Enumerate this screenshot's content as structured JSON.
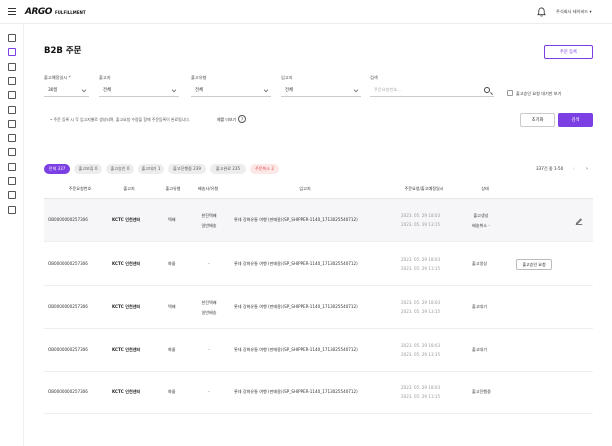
{
  "header": {
    "logo_main": "ARGO",
    "logo_sub": "FULFILLMENT",
    "account_name": "주식회사 테이비드 ▾"
  },
  "sidebar": {
    "icons": [
      "home-icon",
      "orders-icon",
      "user-icon",
      "card-icon",
      "box-icon",
      "document-icon",
      "list-icon",
      "truck-icon",
      "inbox-icon",
      "chart-icon",
      "settings-icon",
      "megaphone-icon",
      "book-icon"
    ]
  },
  "page": {
    "title": "B2B 주문",
    "register_button": "주문 등록"
  },
  "filters": {
    "date_label": "출고예정일시 *",
    "date_value": "30일",
    "shipper_label": "출고지",
    "shipper_value": "전체",
    "type_label": "출고유형",
    "type_value": "전체",
    "dest_label": "입고지",
    "dest_value": "전체",
    "search_label": "검색",
    "search_placeholder": "주문요청번호...",
    "checkbox_label": "출고승인 요청 대기만 보기"
  },
  "notice": {
    "text": "주문 등록 시 각 입고지별로 생성되며, 출고요청 수량을 함께 주문등록이 완료됩니다.",
    "help_link": "예를 더보기",
    "help_icon": "?"
  },
  "actions": {
    "reset_label": "초기화",
    "search_label": "검색"
  },
  "tabs": [
    {
      "label": "전체 337",
      "active": true
    },
    {
      "label": "출고보류 0",
      "active": false
    },
    {
      "label": "출고승인 0",
      "active": false
    },
    {
      "label": "출고대기 1",
      "active": false
    },
    {
      "label": "출고진행중 239",
      "active": false
    },
    {
      "label": "출고완료 235",
      "active": false
    },
    {
      "label": "주문취소 2",
      "active": false
    }
  ],
  "pagination": {
    "summary": "337건 중 1-50",
    "prev": "‹",
    "next": "›"
  },
  "table": {
    "columns": [
      "주문요청번호",
      "출고지",
      "출고유형",
      "배송사/유형",
      "입고지",
      "주문요청/출고예정일시",
      "상태"
    ],
    "rows": [
      {
        "order_no": "OB0000000257306",
        "shipper": "KCTC 인천센터",
        "type": "택배",
        "carrier": [
          "한진택배",
          "일반배송"
        ],
        "dest": "롯데 강화유통 여행 (판매용)(SP_SHIPPER-1140_1713025540712)",
        "dates": [
          "2023. 05. 29 18:03",
          "2023. 05. 29 13:15"
        ],
        "status": "출고생성",
        "status_sub": "배송취소 -",
        "action": "edit"
      },
      {
        "order_no": "OB0000000257306",
        "shipper": "KCTC 인천센터",
        "type": "화물",
        "carrier": [
          "-"
        ],
        "dest": "롯데 강화유통 여행 (판매용)(SP_SHIPPER-1140_1713025540712)",
        "dates": [
          "2023. 05. 29 18:03",
          "2023. 05. 29 13:15"
        ],
        "status": "출고생성",
        "status_sub": "",
        "action": "출고승인 요청"
      },
      {
        "order_no": "OB0000000257306",
        "shipper": "KCTC 인천센터",
        "type": "택배",
        "carrier": [
          "한진택배",
          "일반배송"
        ],
        "dest": "롯데 강화유통 여행 (판매용)(SP_SHIPPER-1140_1713025540712)",
        "dates": [
          "2023. 05. 29 18:03",
          "2023. 05. 29 13:15"
        ],
        "status": "출고대기",
        "status_sub": "",
        "action": ""
      },
      {
        "order_no": "OB0000000257306",
        "shipper": "KCTC 인천센터",
        "type": "화물",
        "carrier": [
          "-"
        ],
        "dest": "롯데 강화유통 여행 (판매용)(SP_SHIPPER-1140_1713025540712)",
        "dates": [
          "2023. 05. 29 18:03",
          "2023. 05. 29 13:15"
        ],
        "status": "출고대기",
        "status_sub": "",
        "action": ""
      },
      {
        "order_no": "OB0000000257306",
        "shipper": "KCTC 인천센터",
        "type": "화물",
        "carrier": [
          "-"
        ],
        "dest": "롯데 강화유통 여행 (판매용)(SP_SHIPPER-1140_1713025540712)",
        "dates": [
          "2023. 05. 29 18:03",
          "2023. 05. 29 13:15"
        ],
        "status": "출고진행중",
        "status_sub": "",
        "action": ""
      }
    ]
  },
  "colors": {
    "accent": "#7b3fe4",
    "danger": "#e04848"
  }
}
